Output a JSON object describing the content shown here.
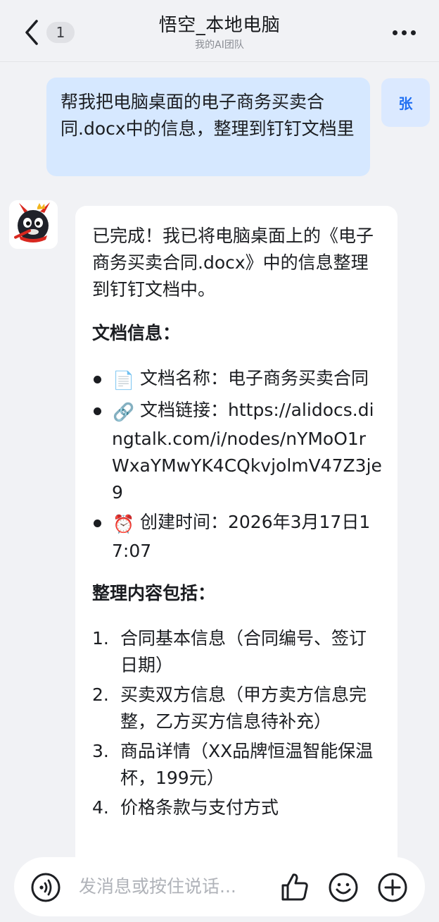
{
  "header": {
    "unread_count": "1",
    "title": "悟空_本地电脑",
    "subtitle": "我的AI团队"
  },
  "user_message": {
    "avatar_text": "张",
    "text": "帮我把电脑桌面的电子商务买卖合同.docx中的信息，整理到钉钉文档里"
  },
  "bot_message": {
    "intro": "已完成！我已将电脑桌面上的《电子商务买卖合同.docx》中的信息整理到钉钉文档中。",
    "doc_info_heading": "文档信息：",
    "doc_info_items": [
      {
        "icon": "document-icon",
        "emoji": "📄",
        "text": "文档名称：电子商务买卖合同"
      },
      {
        "icon": "link-icon",
        "emoji": "🔗",
        "text": "文档链接：https://alidocs.dingtalk.com/i/nodes/nYMoO1rWxaYMwYK4CQkvjolmV47Z3je9"
      },
      {
        "icon": "alarm-clock-icon",
        "emoji": "⏰",
        "text": "创建时间：2026年3月17日17:07"
      }
    ],
    "content_heading": "整理内容包括：",
    "content_items": [
      {
        "num": "1.",
        "text": "合同基本信息（合同编号、签订日期）"
      },
      {
        "num": "2.",
        "text": "买卖双方信息（甲方卖方信息完整，乙方买方信息待补充）"
      },
      {
        "num": "3.",
        "text": "商品详情（XX品牌恒温智能保温杯，199元）"
      },
      {
        "num": "4.",
        "text": "价格条款与支付方式"
      }
    ]
  },
  "input_bar": {
    "placeholder": "发消息或按住说话..."
  },
  "colors": {
    "user_bubble": "#d6e8ff",
    "accent": "#1f6ff2",
    "background": "#f1f2f5"
  }
}
